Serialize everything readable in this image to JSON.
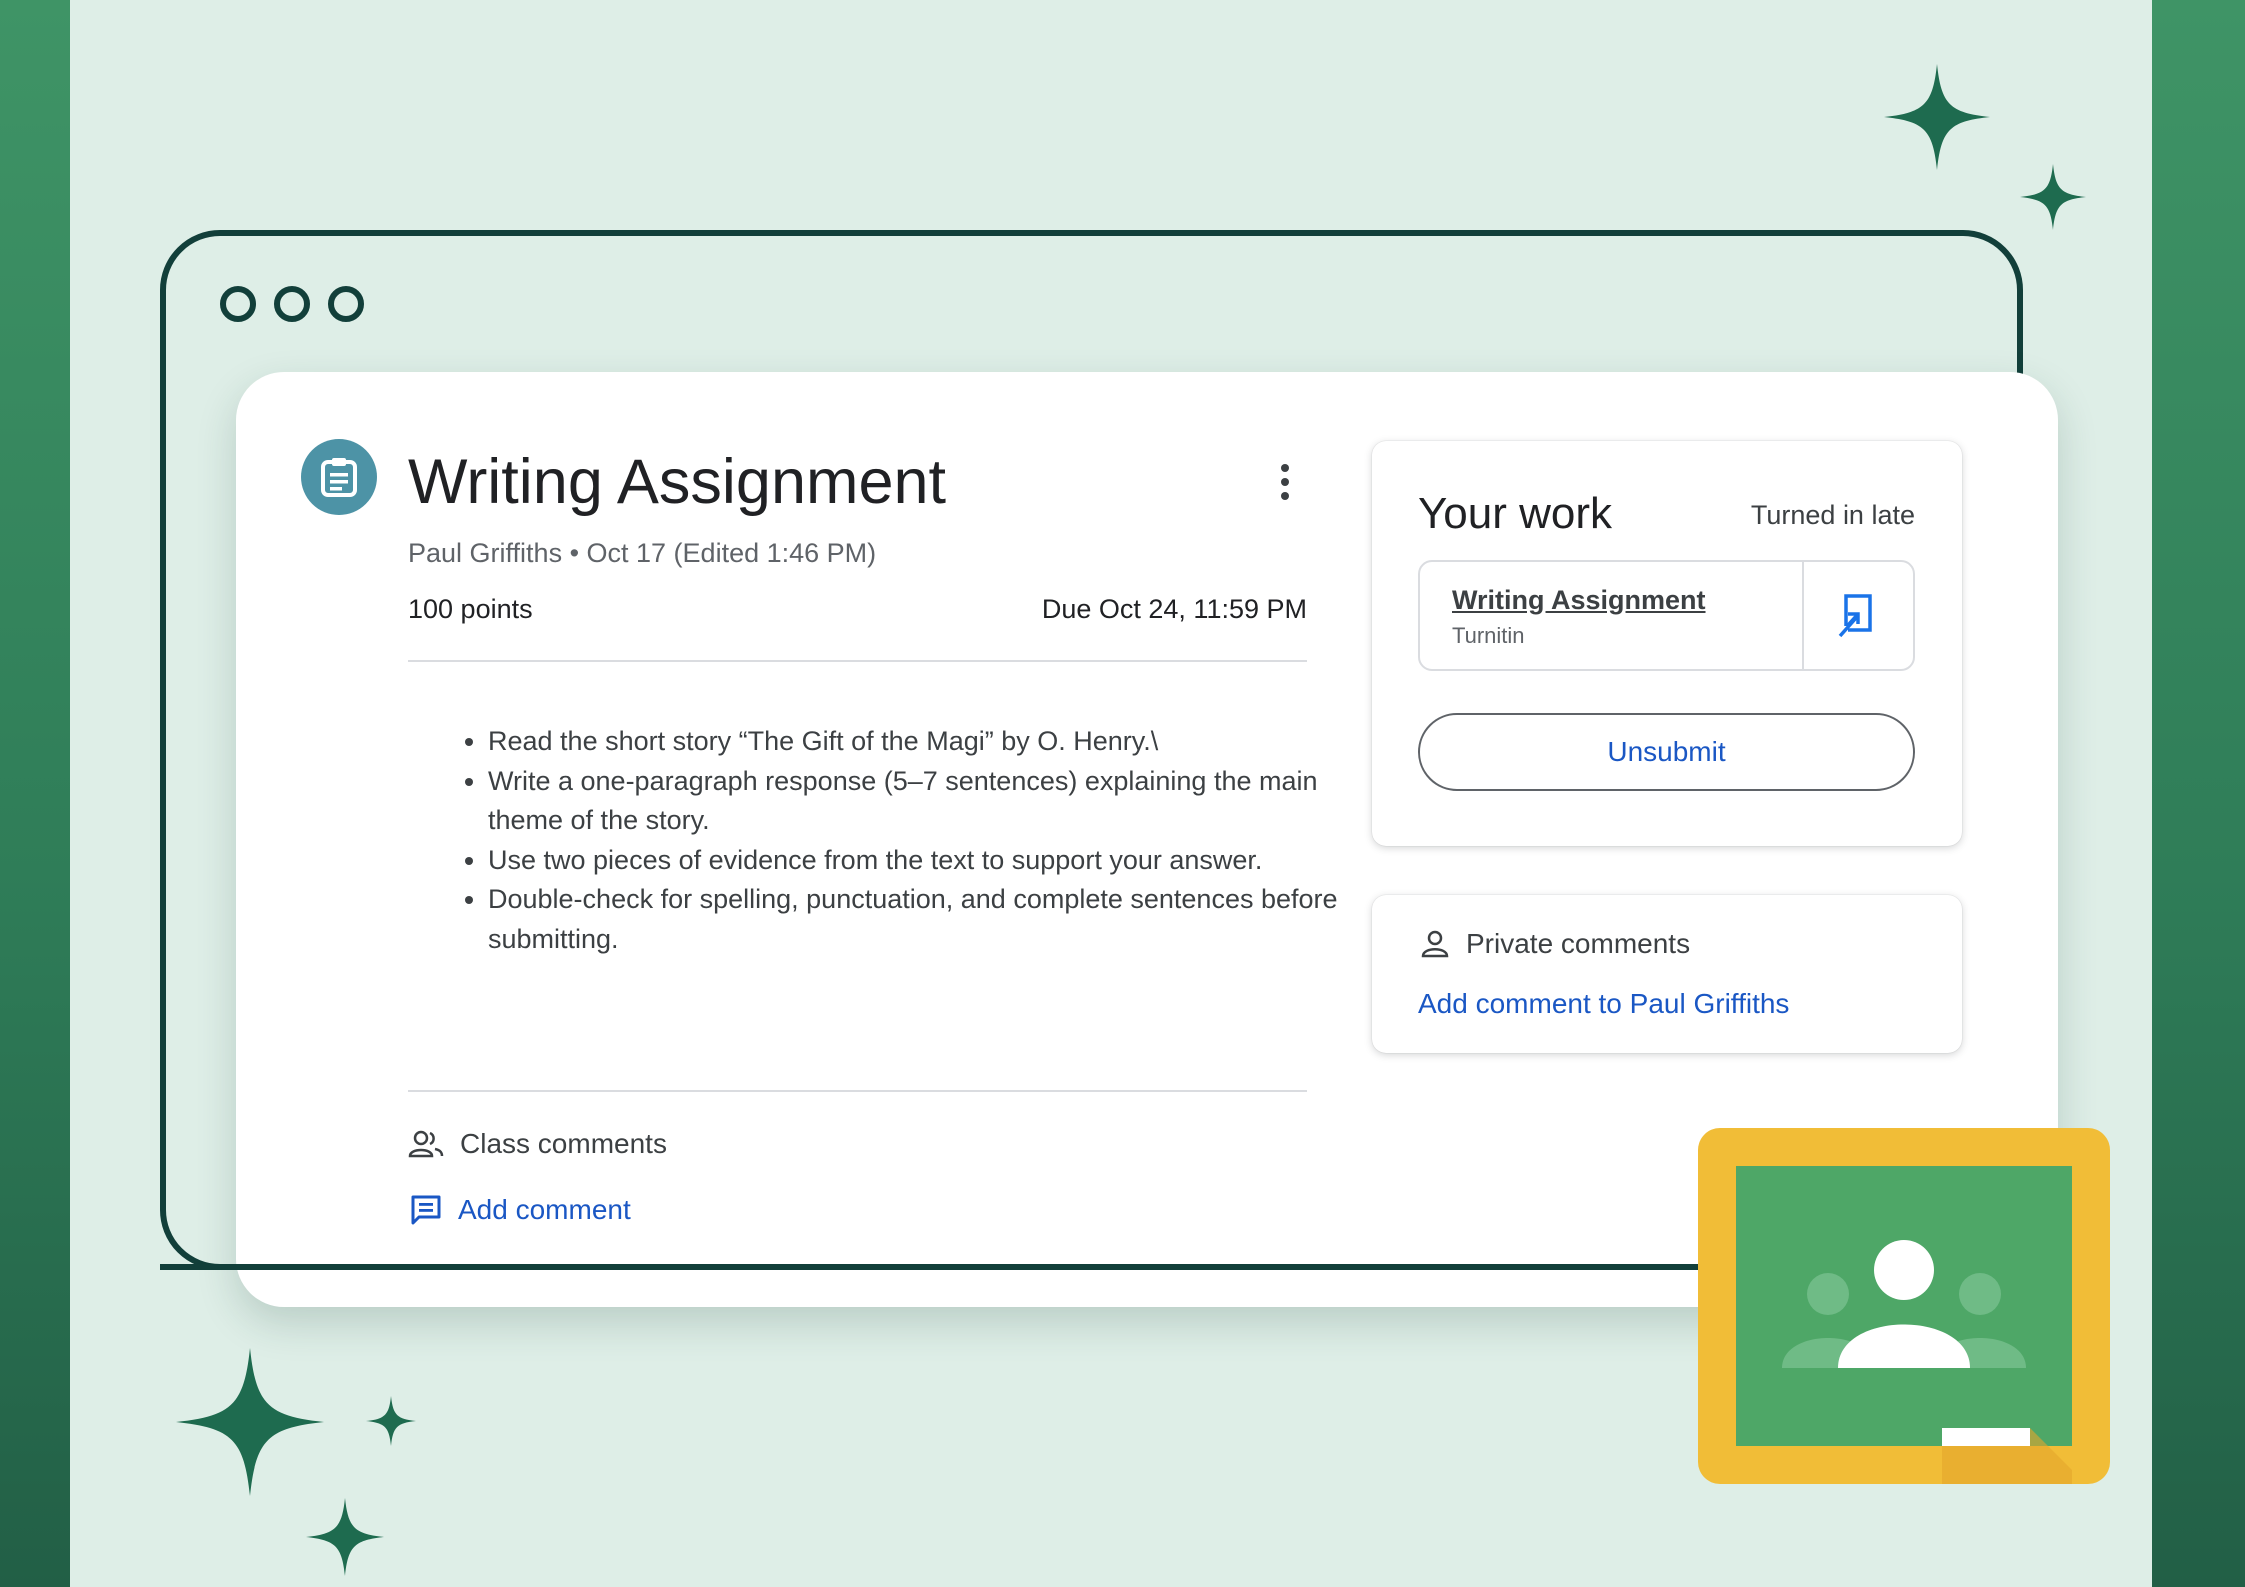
{
  "assignment": {
    "title": "Writing Assignment",
    "meta": "Paul Griffiths • Oct 17 (Edited 1:46 PM)",
    "points": "100 points",
    "due": "Due Oct 24, 11:59 PM",
    "instructions": [
      "Read the short story “The Gift of the Magi” by O. Henry.\\",
      "Write a one-paragraph response (5–7 sentences) explaining the main theme of the story.",
      "Use two pieces of evidence from the text to support your answer.",
      "Double-check for spelling, punctuation, and complete sentences before submitting."
    ]
  },
  "class_comments": {
    "label": "Class comments",
    "add_label": "Add comment"
  },
  "your_work": {
    "title": "Your work",
    "status": "Turned in late",
    "attachment": {
      "name": "Writing Assignment",
      "source": "Turnitin"
    },
    "unsubmit_label": "Unsubmit"
  },
  "private_comments": {
    "label": "Private comments",
    "add_label": "Add comment to Paul Griffiths"
  },
  "colors": {
    "accent_blue": "#1a57c4",
    "frame_dark": "#123f3a",
    "sparkle": "#1e6b4f",
    "classroom_green": "#4ea767",
    "classroom_yellow": "#f1bd37"
  }
}
